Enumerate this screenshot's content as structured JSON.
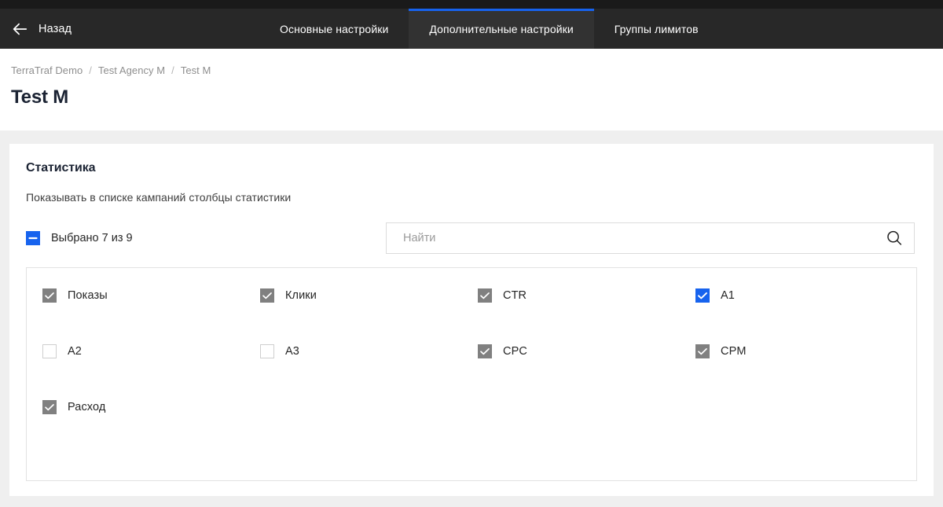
{
  "nav": {
    "back_label": "Назад",
    "back_icon": "arrow-left-icon",
    "tabs": [
      {
        "label": "Основные настройки",
        "active": false
      },
      {
        "label": "Дополнительные настройки",
        "active": true
      },
      {
        "label": "Группы лимитов",
        "active": false
      }
    ],
    "active_tab_accent": "#1763ee"
  },
  "header": {
    "breadcrumb": [
      "TerraTraf Demo",
      "Test Agency M",
      "Test M"
    ],
    "separator": "/",
    "title": "Test M"
  },
  "card": {
    "title": "Статистика",
    "subtitle": "Показывать в списке кампаний столбцы статистики",
    "summary_label": "Выбрано 7 из 9",
    "summary_checkbox_state": "indeterminate",
    "search": {
      "placeholder": "Найти",
      "value": "",
      "icon": "search-icon"
    },
    "options": [
      {
        "label": "Показы",
        "state": "checked-gray"
      },
      {
        "label": "Клики",
        "state": "checked-gray"
      },
      {
        "label": "CTR",
        "state": "checked-gray"
      },
      {
        "label": "A1",
        "state": "checked-blue"
      },
      {
        "label": "A2",
        "state": "unchecked"
      },
      {
        "label": "A3",
        "state": "unchecked"
      },
      {
        "label": "CPC",
        "state": "checked-gray"
      },
      {
        "label": "CPM",
        "state": "checked-gray"
      },
      {
        "label": "Расход",
        "state": "checked-gray"
      }
    ]
  },
  "colors": {
    "accent": "#1763ee",
    "nav_bg": "#282828",
    "nav_top_strip": "#1a1a1a",
    "active_tab_bg": "#323232",
    "checked_gray": "#808080",
    "page_bg": "#efefef"
  }
}
